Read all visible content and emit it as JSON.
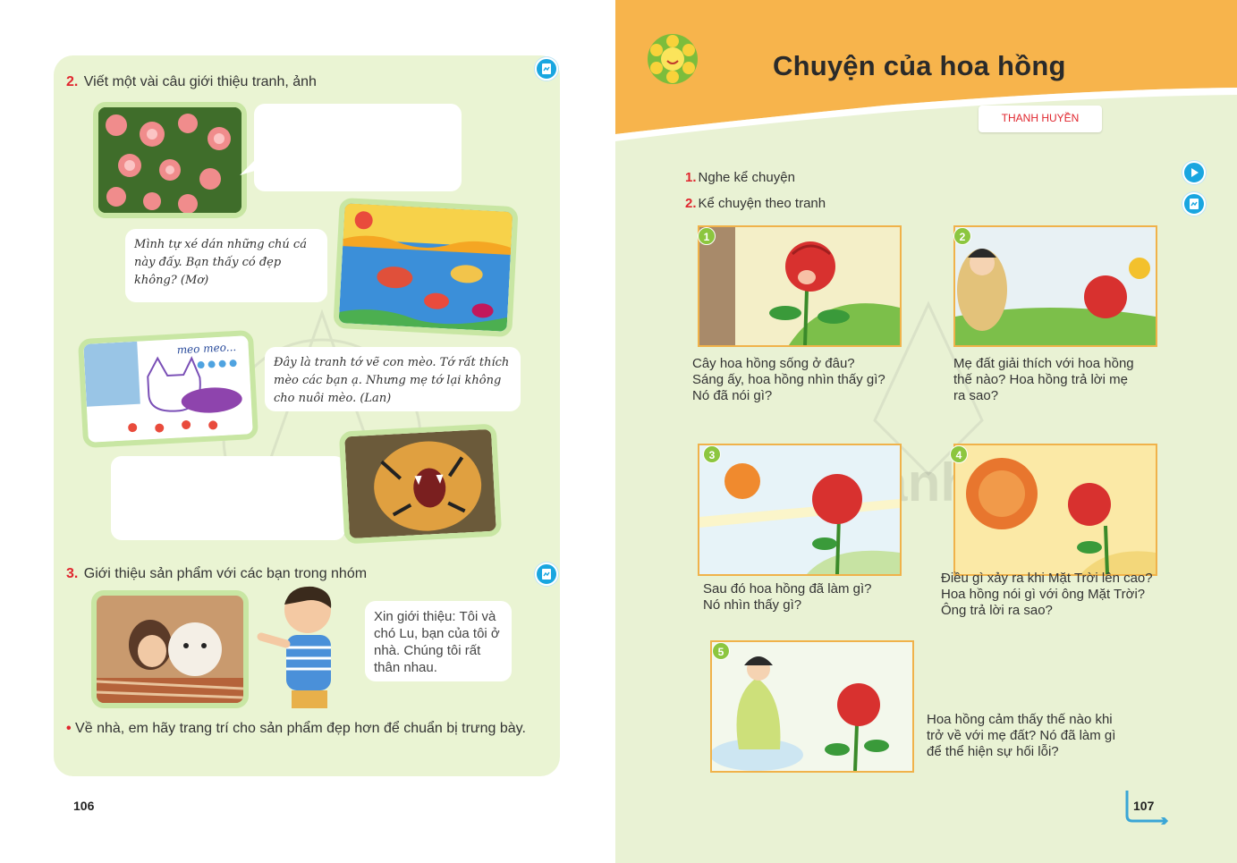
{
  "left": {
    "section2_num": "2.",
    "section2_title": "Viết một vài câu giới thiệu tranh, ảnh",
    "bubble_fish": "Mình tự xé dán những chú cá này đấy. Bạn thấy có đẹp không? (Mơ)",
    "drawing_text": "meo meo...",
    "bubble_cat": "Đây là tranh tớ vẽ con mèo. Tớ rất thích mèo các bạn ạ. Nhưng mẹ tớ lại không cho nuôi mèo. (Lan)",
    "section3_num": "3.",
    "section3_title": "Giới thiệu sản phẩm với các bạn trong nhóm",
    "bubble_dog": "Xin giới thiệu: Tôi và chó Lu, bạn của tôi ở nhà. Chúng tôi rất thân nhau.",
    "homework": "Về nhà, em hãy trang trí cho sản phẩm đẹp hơn để chuẩn bị trưng bày.",
    "page_number": "106",
    "watermark": "Cánh Diều"
  },
  "right": {
    "title": "Chuyện của hoa hồng",
    "author": "THANH HUYỀN",
    "item1_num": "1.",
    "item1": "Nghe kể chuyện",
    "item2_num": "2.",
    "item2": "Kể chuyện theo tranh",
    "pictures": [
      {
        "num": "1",
        "q1": "Cây hoa hồng sống ở đâu?",
        "q2": "Sáng ấy, hoa hồng nhìn thấy gì?",
        "q3": "Nó đã nói gì?"
      },
      {
        "num": "2",
        "q1": "Mẹ đất giải thích với hoa hồng",
        "q2": "thế nào? Hoa hồng trả lời mẹ",
        "q3": "ra sao?"
      },
      {
        "num": "3",
        "q1": "Sau đó hoa hồng đã làm gì?",
        "q2": "Nó nhìn thấy gì?",
        "q3": ""
      },
      {
        "num": "4",
        "q1": "Điều gì xảy ra khi Mặt Trời lên cao?",
        "q2": "Hoa hồng nói gì với ông Mặt Trời?",
        "q3": "Ông trả lời ra sao?"
      },
      {
        "num": "5",
        "q1": "Hoa hồng cảm thấy thế nào khi",
        "q2": "trở về với mẹ đất? Nó đã làm gì",
        "q3": "để thể hiện sự hối lỗi?"
      }
    ],
    "page_number": "107"
  },
  "colors": {
    "accent_red": "#e0262e",
    "orange_band": "#f7b44c",
    "panel_green": "#eaf4d3",
    "icon_blue": "#19a6e0"
  }
}
